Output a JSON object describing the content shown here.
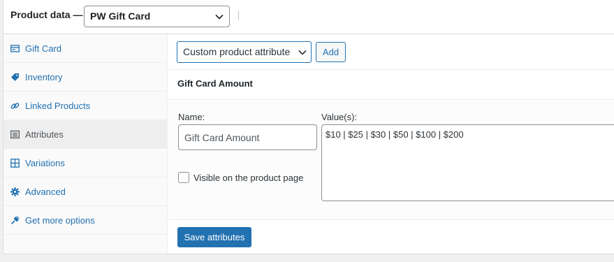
{
  "header": {
    "title": "Product data —",
    "product_type": "PW Gift Card",
    "product_type_chevron": "chevron-down-icon"
  },
  "tabs": [
    {
      "label": "Gift Card",
      "icon": "gift-card-icon",
      "active": false
    },
    {
      "label": "Inventory",
      "icon": "tag-icon",
      "active": false
    },
    {
      "label": "Linked Products",
      "icon": "link-icon",
      "active": false
    },
    {
      "label": "Attributes",
      "icon": "list-icon",
      "active": true
    },
    {
      "label": "Variations",
      "icon": "grid-icon",
      "active": false
    },
    {
      "label": "Advanced",
      "icon": "gear-icon",
      "active": false
    },
    {
      "label": "Get more options",
      "icon": "plugin-icon",
      "active": false
    }
  ],
  "toolbar": {
    "attribute_select": "Custom product attribute",
    "add_label": "Add"
  },
  "attribute": {
    "title": "Gift Card Amount",
    "name_label": "Name:",
    "name_value": "Gift Card Amount",
    "values_label": "Value(s):",
    "values_value": "$10 | $25 | $30 | $50 | $100 | $200",
    "visible_label": "Visible on the product page",
    "visible_checked": false
  },
  "save_label": "Save attributes",
  "colors": {
    "accent": "#2271b1",
    "active_tab_bg": "#eeeeee"
  }
}
